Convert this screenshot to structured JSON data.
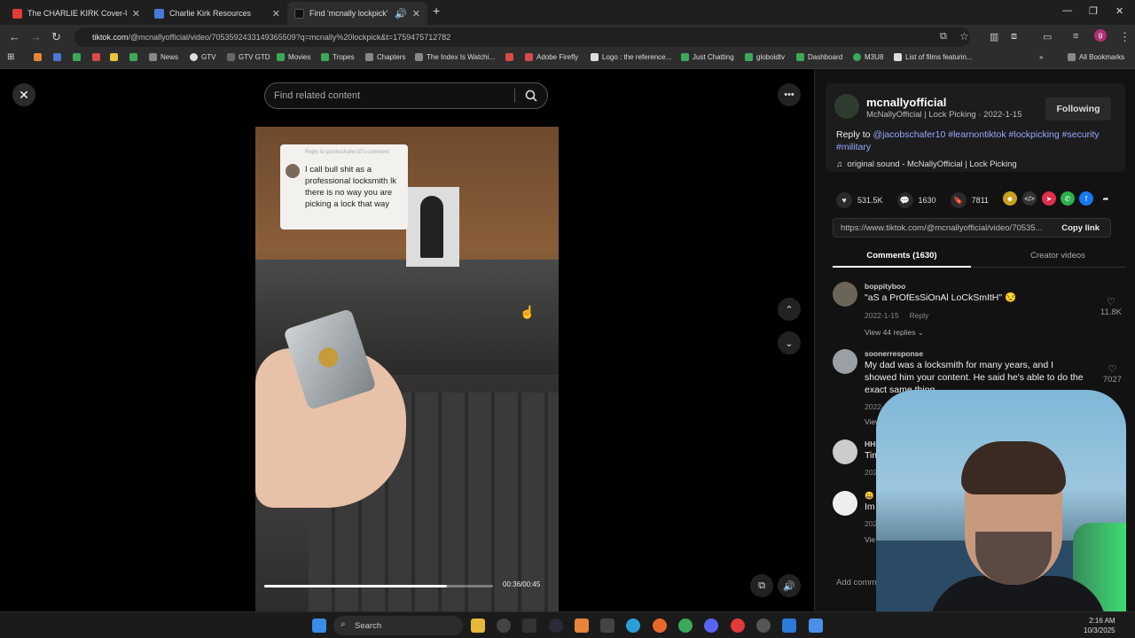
{
  "browser": {
    "tabs": [
      {
        "title": "The CHARLIE KIRK Cover-Up: th",
        "favicon_color": "#e03a3a"
      },
      {
        "title": "Charlie Kirk Resources",
        "favicon_color": "#4a78d8"
      },
      {
        "title": "Find 'mcnally lockpick' on",
        "favicon_color": "#111111"
      }
    ],
    "new_tab": "+",
    "address": {
      "host": "tiktok.com",
      "path": "/@mcnallyofficial/video/7053592433149365509?q=mcnally%20lockpick&t=1759475712782"
    },
    "bookmarks": [
      {
        "label": "",
        "color": "#e8843a"
      },
      {
        "label": "",
        "color": "#4a78d8"
      },
      {
        "label": "",
        "color": "#3aaa5a"
      },
      {
        "label": "",
        "color": "#d84a4a"
      },
      {
        "label": "",
        "color": "#e8c43a"
      },
      {
        "label": "",
        "color": "#3aaa5a"
      },
      {
        "label": "News",
        "color": "#888888"
      },
      {
        "label": "GTV",
        "color": "#dddddd"
      },
      {
        "label": "GTV GTD",
        "color": "#666666"
      },
      {
        "label": "Movies",
        "color": "#3aaa5a"
      },
      {
        "label": "Tropes",
        "color": "#3aaa5a"
      },
      {
        "label": "Chapters",
        "color": "#888888"
      },
      {
        "label": "The Index Is Watchi...",
        "color": "#888888"
      },
      {
        "label": "",
        "color": "#d84a4a"
      },
      {
        "label": "Adobe Firefly",
        "color": "#d84a4a"
      },
      {
        "label": "Logo : the reference...",
        "color": "#dddddd"
      },
      {
        "label": "Just Chatting",
        "color": "#3aaa5a"
      },
      {
        "label": "globoidtv",
        "color": "#3aaa5a"
      },
      {
        "label": "Dashboard",
        "color": "#3aaa5a"
      },
      {
        "label": "M3U8",
        "color": "#3aaa5a"
      },
      {
        "label": "List of films featurin...",
        "color": "#dddddd"
      }
    ],
    "all_bookmarks": "All Bookmarks"
  },
  "search": {
    "placeholder": "Find related content"
  },
  "video": {
    "reply_header": "Reply to jacobschafer10's comment",
    "reply_text": "I call bull shit as a professional locksmith lk there is no way you are picking a lock that way",
    "time": "00:36/00:45",
    "progress": 0.8
  },
  "post": {
    "username": "mcnallyofficial",
    "subtitle": "McNallyOfficial | Lock Picking · 2022-1-15",
    "follow_label": "Following",
    "caption_prefix": "Reply to ",
    "caption_mention": "@jacobschafer10",
    "caption_tags": "#learnontiktok #lockpicking #security #military",
    "sound": "original sound - McNallyOfficial | Lock Picking",
    "likes": "531.5K",
    "comments": "1630",
    "saves": "7811",
    "link": "https://www.tiktok.com/@mcnallyofficial/video/70535...",
    "copy_link": "Copy link",
    "tab_comments": "Comments (1630)",
    "tab_creator": "Creator videos"
  },
  "comments": [
    {
      "user": "boppityboo",
      "text": "\"aS a PrOfEsSiOnAl LoCkSmItH\" 😒",
      "date": "2022-1-15",
      "reply": "Reply",
      "likes": "11.8K",
      "replies": "View 44 replies"
    },
    {
      "user": "soonerresponse",
      "text": "My dad was a locksmith for many years, and I showed him your content. He said he's able to do the exact same thing",
      "date": "2022-1-15",
      "likes": "7027",
      "replies": "View 30"
    },
    {
      "user": "HHEa",
      "text": "Tim",
      "date": "202"
    },
    {
      "user": "😀",
      "text": "Im",
      "date": "202",
      "replies": "Vie"
    }
  ],
  "add_comment": "Add comme",
  "taskbar": {
    "search": "Search",
    "time": "2:16 AM",
    "date": "10/3/2025"
  },
  "colors": {
    "accent_link": "#98a7ff",
    "like_red": "#fe2c55"
  }
}
